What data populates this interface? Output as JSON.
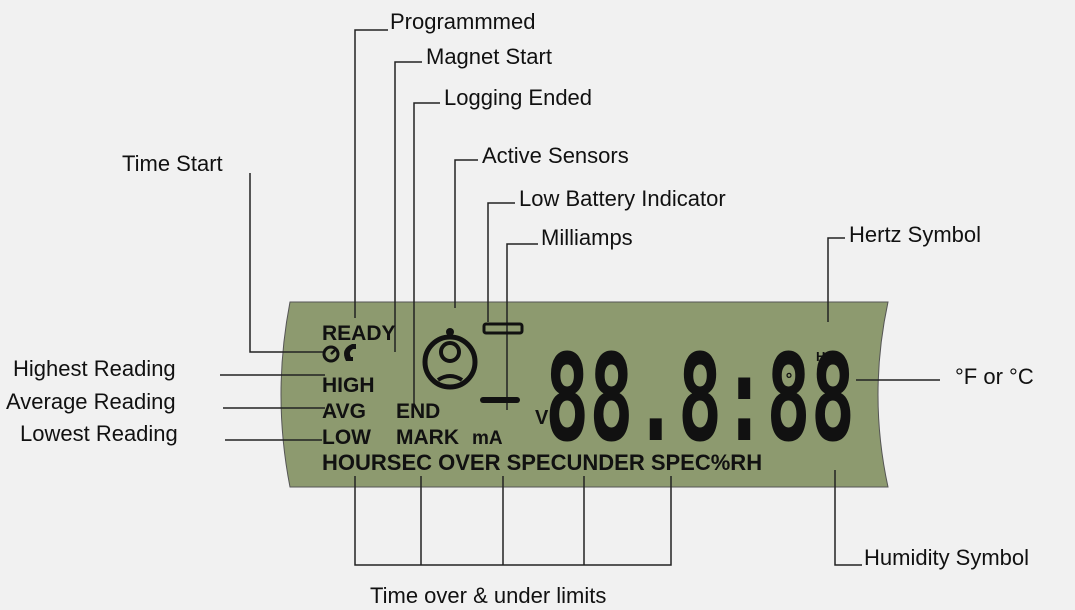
{
  "callouts": {
    "programmed": "Programmmed",
    "magnet_start": "Magnet Start",
    "logging_ended": "Logging Ended",
    "active_sensors": "Active Sensors",
    "low_battery": "Low Battery Indicator",
    "milliamps": "Milliamps",
    "time_start": "Time Start",
    "hertz_symbol": "Hertz Symbol",
    "highest_reading": "Highest Reading",
    "average_reading": "Average Reading",
    "lowest_reading": "Lowest Reading",
    "f_or_c": "°F or °C",
    "humidity_symbol": "Humidity Symbol",
    "time_over_under": "Time over & under limits"
  },
  "lcd": {
    "ready": "READY",
    "high": "HIGH",
    "avg": "AVG",
    "end": "END",
    "low": "LOW",
    "mark": "MARK",
    "ma": "mA",
    "v": "V",
    "hz": "Hz",
    "bottom_row": "HOURSEC OVER SPECUNDER SPEC%RH",
    "digits": "88.8:88",
    "colors": {
      "body": "#8d9a6f",
      "ink": "#111111",
      "background": "#f1f1f1"
    }
  }
}
